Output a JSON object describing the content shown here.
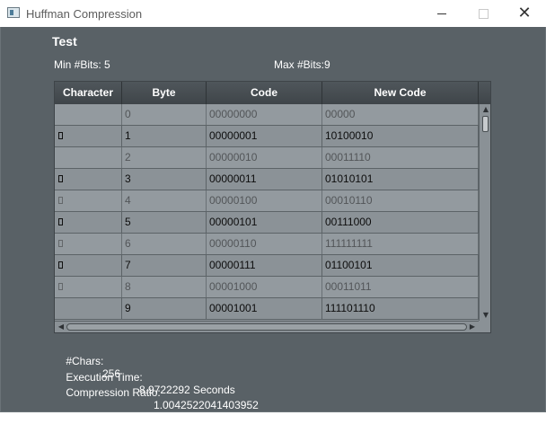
{
  "window": {
    "title": "Huffman Compression",
    "minimize_glyph": "—",
    "close_glyph": "✕"
  },
  "file_name": "Test",
  "bits": {
    "min_label": "Min #Bits: 5",
    "max_label": "Max #Bits:9"
  },
  "table": {
    "columns": [
      "Character",
      "Byte",
      "Code",
      "New Code"
    ],
    "rows": [
      {
        "char": "",
        "glyph": false,
        "byte": "0",
        "code": "00000000",
        "new_code": "00000",
        "dim": true
      },
      {
        "char": "",
        "glyph": true,
        "byte": "1",
        "code": "00000001",
        "new_code": "10100010",
        "dim": false
      },
      {
        "char": "",
        "glyph": false,
        "byte": "2",
        "code": "00000010",
        "new_code": "00011110",
        "dim": true
      },
      {
        "char": "",
        "glyph": true,
        "byte": "3",
        "code": "00000011",
        "new_code": "01010101",
        "dim": false
      },
      {
        "char": "",
        "glyph": true,
        "byte": "4",
        "code": "00000100",
        "new_code": "00010110",
        "dim": true
      },
      {
        "char": "",
        "glyph": true,
        "byte": "5",
        "code": "00000101",
        "new_code": "00111000",
        "dim": false
      },
      {
        "char": "",
        "glyph": true,
        "byte": "6",
        "code": "00000110",
        "new_code": "111111111",
        "dim": true
      },
      {
        "char": "",
        "glyph": true,
        "byte": "7",
        "code": "00000111",
        "new_code": "01100101",
        "dim": false
      },
      {
        "char": "",
        "glyph": true,
        "byte": "8",
        "code": "00001000",
        "new_code": "00011011",
        "dim": true
      },
      {
        "char": "",
        "glyph": false,
        "byte": "9",
        "code": "00001001",
        "new_code": "111101110",
        "dim": false
      }
    ]
  },
  "stats": {
    "chars_label": "#Chars:",
    "chars_value": "256",
    "time_label": "Execution Time:",
    "time_value": "8.9722292 Seconds",
    "ratio_label": "Compression Ratio:",
    "ratio_value": "1.0042522041403952"
  }
}
